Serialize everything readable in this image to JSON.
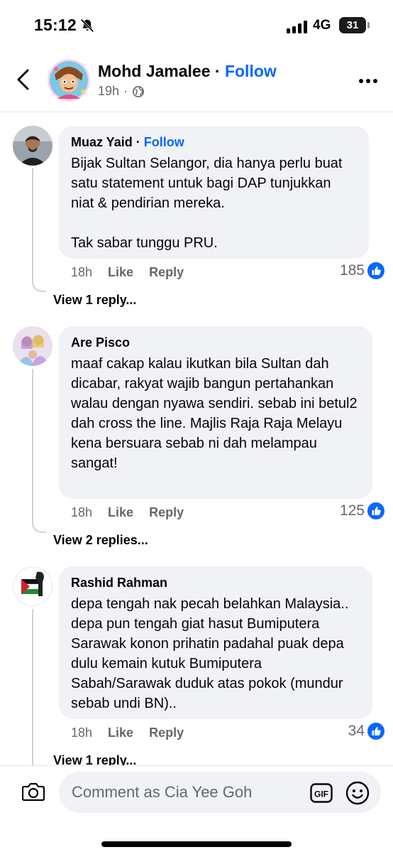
{
  "status_bar": {
    "time": "15:12",
    "network": "4G",
    "battery": "31"
  },
  "post_header": {
    "author": "Mohd Jamalee",
    "separator": "·",
    "follow": "Follow",
    "time": "19h",
    "meta_separator": "·",
    "audience_icon": "globe-icon"
  },
  "comments": [
    {
      "name": "Muaz Yaid",
      "separator": " · ",
      "follow": "Follow",
      "text": "Bijak Sultan Selangor, dia hanya perlu buat satu statement untuk bagi DAP tunjukkan niat & pendirian mereka.\n\nTak sabar tunggu PRU.",
      "time": "18h",
      "like": "Like",
      "reply": "Reply",
      "reactions": "185",
      "replies": "View 1 reply..."
    },
    {
      "name": "Are Pisco",
      "text": "maaf cakap kalau ikutkan bila Sultan dah dicabar, rakyat wajib bangun pertahankan walau dengan nyawa sendiri. sebab ini betul2 dah cross the line. Majlis Raja Raja Melayu kena bersuara sebab ni dah melampau sangat!",
      "time": "18h",
      "like": "Like",
      "reply": "Reply",
      "reactions": "125",
      "replies": "View 2 replies..."
    },
    {
      "name": "Rashid Rahman",
      "text": "depa tengah nak pecah belahkan Malaysia.. depa pun tengah giat hasut Bumiputera Sarawak konon prihatin padahal puak depa dulu kemain kutuk Bumiputera Sabah/Sarawak duduk atas pokok (mundur sebab undi BN)..",
      "time": "18h",
      "like": "Like",
      "reply": "Reply",
      "reactions": "34",
      "replies": "View 1 reply..."
    }
  ],
  "composer": {
    "placeholder": "Comment as Cia Yee Goh",
    "gif": "GIF"
  },
  "colors": {
    "accent": "#0866ff",
    "secondary_text": "#65676b",
    "bubble": "#f0f2f5"
  }
}
